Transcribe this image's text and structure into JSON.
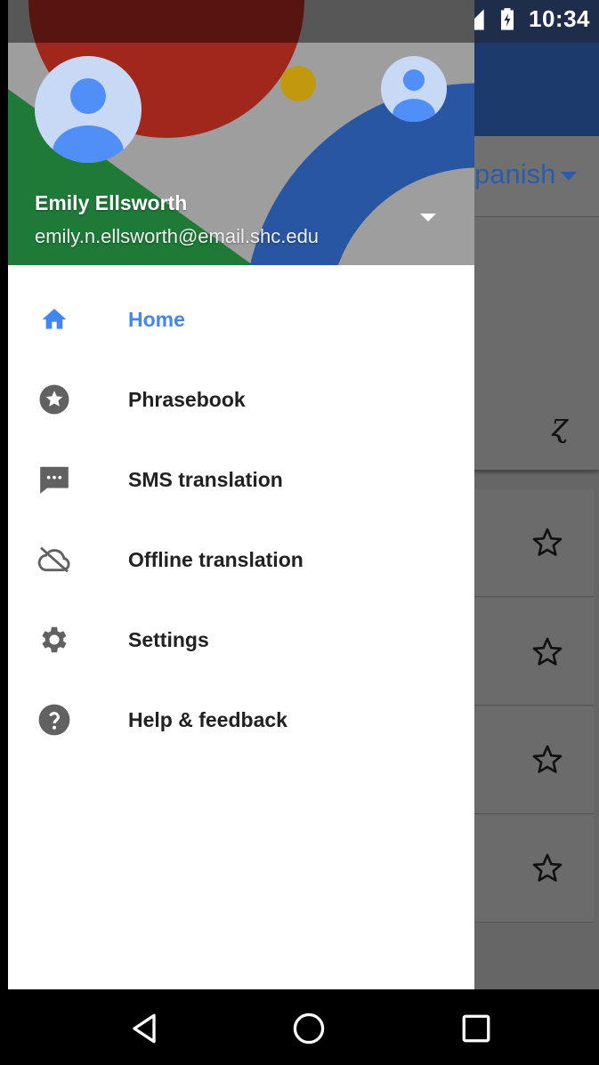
{
  "status_bar": {
    "time": "10:34",
    "left_icons": [
      "image-icon",
      "drive-icon"
    ],
    "right_icons": [
      "cast-icon",
      "do-not-disturb-icon",
      "alarm-icon",
      "wifi-icon",
      "signal-icon",
      "battery-charging-icon"
    ]
  },
  "background_app": {
    "target_language": "panish"
  },
  "account": {
    "name": "Emily Ellsworth",
    "email": "emily.n.ellsworth@email.shc.edu"
  },
  "menu": {
    "items": [
      {
        "label": "Home",
        "icon": "home-icon",
        "active": true
      },
      {
        "label": "Phrasebook",
        "icon": "star-circle-icon",
        "active": false
      },
      {
        "label": "SMS translation",
        "icon": "sms-icon",
        "active": false
      },
      {
        "label": "Offline translation",
        "icon": "cloud-off-icon",
        "active": false
      },
      {
        "label": "Settings",
        "icon": "gear-icon",
        "active": false
      },
      {
        "label": "Help & feedback",
        "icon": "help-icon",
        "active": false
      }
    ]
  },
  "colors": {
    "accent": "#4285f4",
    "menu_text": "#212121",
    "icon_gray": "#757575"
  },
  "nav_bar": {
    "buttons": [
      "back-icon",
      "home-circle-icon",
      "recents-icon"
    ]
  }
}
